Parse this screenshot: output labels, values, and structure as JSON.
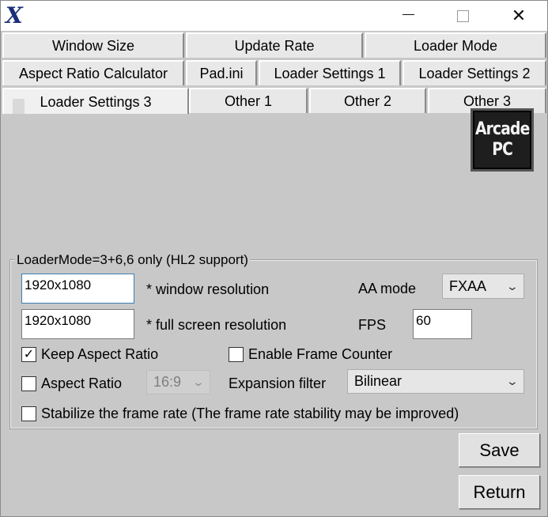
{
  "window": {
    "app_icon": "X",
    "minimize_icon": "minimize-icon",
    "maximize_icon": "maximize-icon",
    "close_icon": "close-icon",
    "close_glyph": "✕"
  },
  "tabs": {
    "row1": [
      "Window Size",
      "Update Rate",
      "Loader Mode"
    ],
    "row2": [
      "Aspect Ratio Calculator",
      "Pad.ini",
      "Loader Settings 1",
      "Loader Settings 2"
    ],
    "row3": [
      "Loader Settings 3",
      "Other 1",
      "Other 2",
      "Other 3"
    ],
    "active": "Loader Settings 3"
  },
  "logo": {
    "line1": "Arcade",
    "line2": "PC"
  },
  "group": {
    "title": "LoaderMode=3+6,6 only (HL2 support)",
    "window_resolution_value": "1920x1080",
    "window_resolution_label": "* window resolution",
    "fullscreen_resolution_value": "1920x1080",
    "fullscreen_resolution_label": "* full screen resolution",
    "aa_mode_label": "AA mode",
    "aa_mode_value": "FXAA",
    "fps_label": "FPS",
    "fps_value": "60",
    "keep_aspect_label": "Keep Aspect Ratio",
    "keep_aspect_checked": true,
    "check_glyph": "✓",
    "frame_counter_label": "Enable Frame Counter",
    "aspect_ratio_label": "Aspect Ratio",
    "aspect_ratio_value": "16:9",
    "expansion_filter_label": "Expansion filter",
    "expansion_filter_value": "Bilinear",
    "stabilize_label": "Stabilize the frame rate (The frame rate stability may be improved)",
    "chevron_glyph": "⌄"
  },
  "buttons": {
    "save": "Save",
    "return": "Return"
  }
}
